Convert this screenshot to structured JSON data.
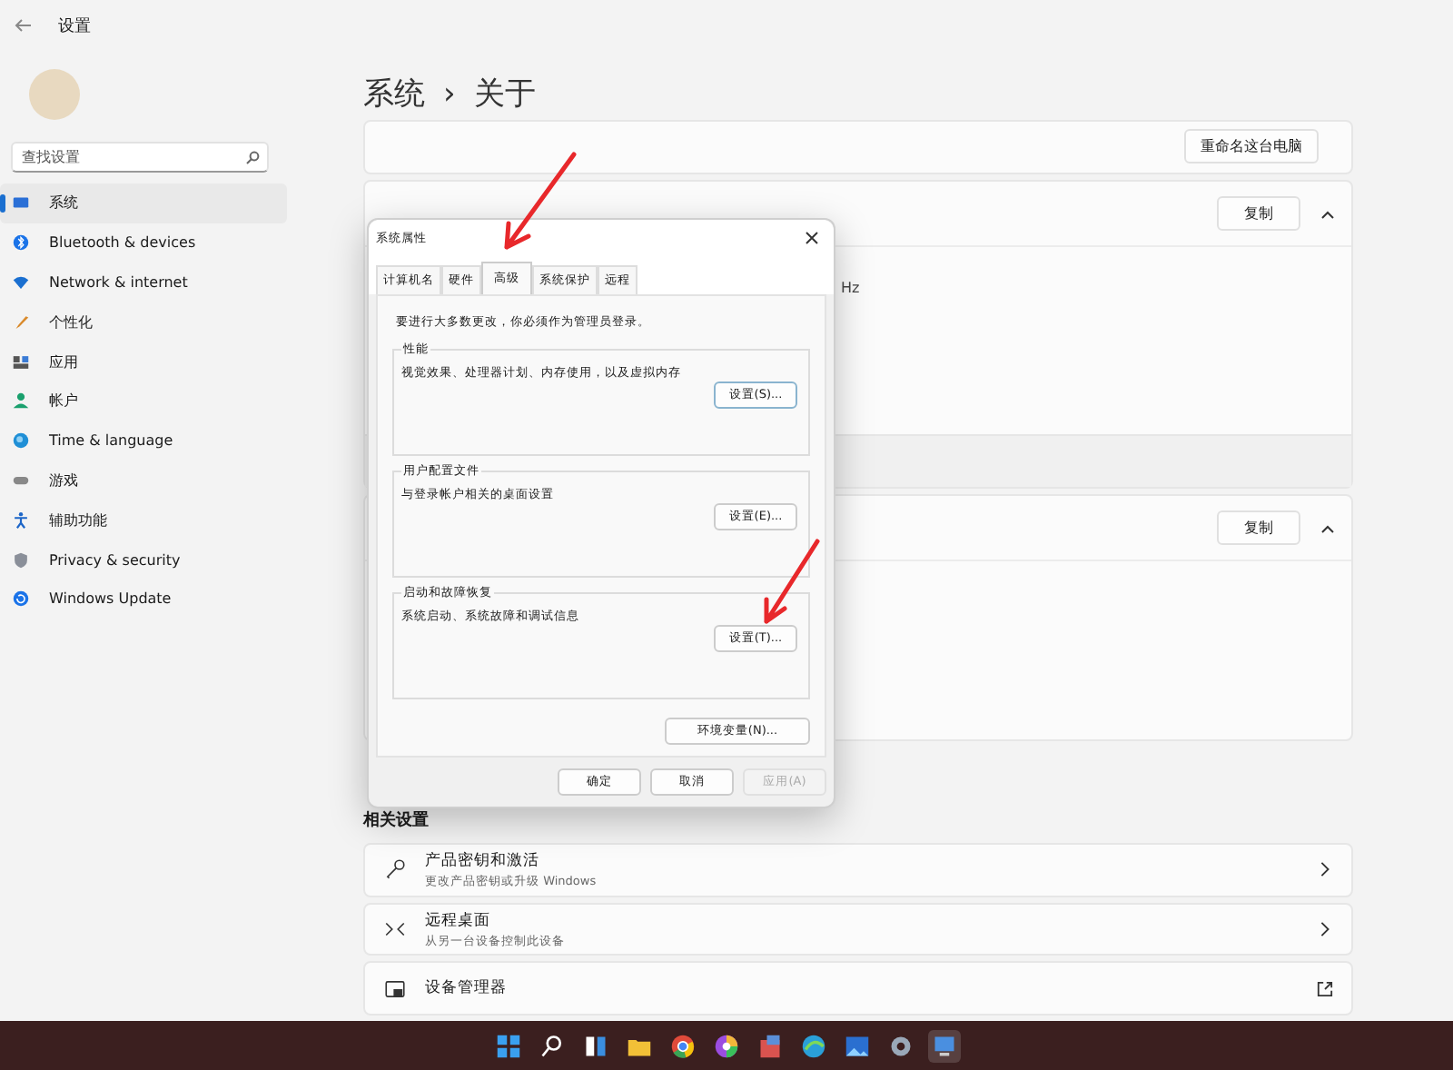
{
  "window": {
    "title": "设置"
  },
  "sidebar": {
    "search": {
      "placeholder": "查找设置"
    },
    "items": [
      {
        "label": "系统",
        "selected": true
      },
      {
        "label": "Bluetooth & devices",
        "selected": false
      },
      {
        "label": "Network & internet",
        "selected": false
      },
      {
        "label": "个性化",
        "selected": false
      },
      {
        "label": "应用",
        "selected": false
      },
      {
        "label": "帐户",
        "selected": false
      },
      {
        "label": "Time & language",
        "selected": false
      },
      {
        "label": "游戏",
        "selected": false
      },
      {
        "label": "辅助功能",
        "selected": false
      },
      {
        "label": "Privacy & security",
        "selected": false
      },
      {
        "label": "Windows Update",
        "selected": false
      }
    ]
  },
  "main": {
    "breadcrumb": {
      "parent": "系统",
      "separator": "›",
      "current": "关于"
    },
    "cards": [
      {
        "kind": "rename",
        "button": "重命名这台电脑"
      },
      {
        "kind": "spec",
        "button": "复制",
        "expanded": true,
        "fragment": "Hz"
      },
      {
        "kind": "spec",
        "button": "复制",
        "expanded": true
      }
    ],
    "related": {
      "title": "相关设置",
      "items": [
        {
          "kind": "internal",
          "title": "产品密钥和激活",
          "subtitle": "更改产品密钥或升级 Windows"
        },
        {
          "kind": "internal",
          "title": "远程桌面",
          "subtitle": "从另一台设备控制此设备"
        },
        {
          "kind": "external",
          "title": "设备管理器"
        }
      ]
    }
  },
  "dialog": {
    "title": "系统属性",
    "tabs": [
      {
        "label": "计算机名",
        "selected": false
      },
      {
        "label": "硬件",
        "selected": false
      },
      {
        "label": "高级",
        "selected": true
      },
      {
        "label": "系统保护",
        "selected": false
      },
      {
        "label": "远程",
        "selected": false
      }
    ],
    "note": "要进行大多数更改，你必须作为管理员登录。",
    "groups": [
      {
        "legend": "性能",
        "text": "视觉效果、处理器计划、内存使用，以及虚拟内存",
        "button": "设置(S)...",
        "focused": true
      },
      {
        "legend": "用户配置文件",
        "text": "与登录帐户相关的桌面设置",
        "button": "设置(E)...",
        "focused": false
      },
      {
        "legend": "启动和故障恢复",
        "text": "系统启动、系统故障和调试信息",
        "button": "设置(T)...",
        "focused": false
      }
    ],
    "env_button": "环境变量(N)...",
    "buttons": [
      {
        "label": "确定",
        "disabled": false
      },
      {
        "label": "取消",
        "disabled": false
      },
      {
        "label": "应用(A)",
        "disabled": true
      }
    ]
  },
  "taskbar": {
    "icons": [
      {
        "active": false
      },
      {
        "active": false
      },
      {
        "active": false
      },
      {
        "active": false
      },
      {
        "active": false
      },
      {
        "active": false
      },
      {
        "active": false
      },
      {
        "active": false
      },
      {
        "active": false
      },
      {
        "active": false
      },
      {
        "active": true
      }
    ]
  }
}
